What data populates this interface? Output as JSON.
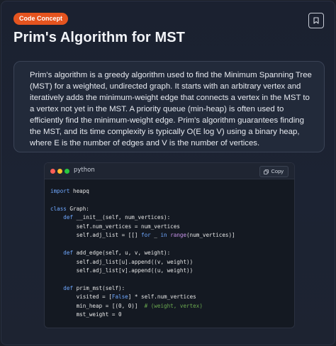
{
  "badge": "Code Concept",
  "title": "Prim's Algorithm for MST",
  "description": "Prim's algorithm is a greedy algorithm used to find the Minimum Spanning Tree (MST) for a weighted, undirected graph. It starts with an arbitrary vertex and iteratively adds the minimum-weight edge that connects a vertex in the MST to a vertex not yet in the MST. A priority queue (min-heap) is often used to efficiently find the minimum-weight edge. Prim's algorithm guarantees finding the MST, and its time complexity is typically O(E log V) using a binary heap, where E is the number of edges and V is the number of vertices.",
  "code_block": {
    "language": "python",
    "copy_label": "Copy",
    "lines": {
      "l1": {
        "kw": "import",
        "rest": " heapq"
      },
      "l3": {
        "kw": "class",
        "rest": " Graph:"
      },
      "l4": {
        "indent": "    ",
        "kw": "def",
        "rest": " __init__(self, num_vertices):"
      },
      "l5": {
        "text": "        self.num_vertices = num_vertices"
      },
      "l6": {
        "a": "        self.adj_list = [[] ",
        "kw1": "for",
        "b": " _ ",
        "kw2": "in",
        "c": " ",
        "bi": "range",
        "d": "(num_vertices)]"
      },
      "l8": {
        "indent": "    ",
        "kw": "def",
        "rest": " add_edge(self, u, v, weight):"
      },
      "l9": {
        "text": "        self.adj_list[u].append((v, weight))"
      },
      "l10": {
        "text": "        self.adj_list[v].append((u, weight))"
      },
      "l12": {
        "indent": "    ",
        "kw": "def",
        "rest": " prim_mst(self):"
      },
      "l13": {
        "a": "        visited = [",
        "kw": "False",
        "b": "] * self.num_vertices"
      },
      "l14": {
        "a": "        min_heap = [(0, 0)]  ",
        "cm": "# (weight, vertex)"
      },
      "l15": {
        "text": "        mst_weight = 0"
      }
    }
  },
  "colors": {
    "badge_bg": "#e5541f",
    "keyword": "#6fa8ff",
    "builtin": "#c792ea",
    "comment": "#6aa84f"
  },
  "icons": {
    "bookmark": "bookmark-icon",
    "copy": "copy-icon"
  }
}
